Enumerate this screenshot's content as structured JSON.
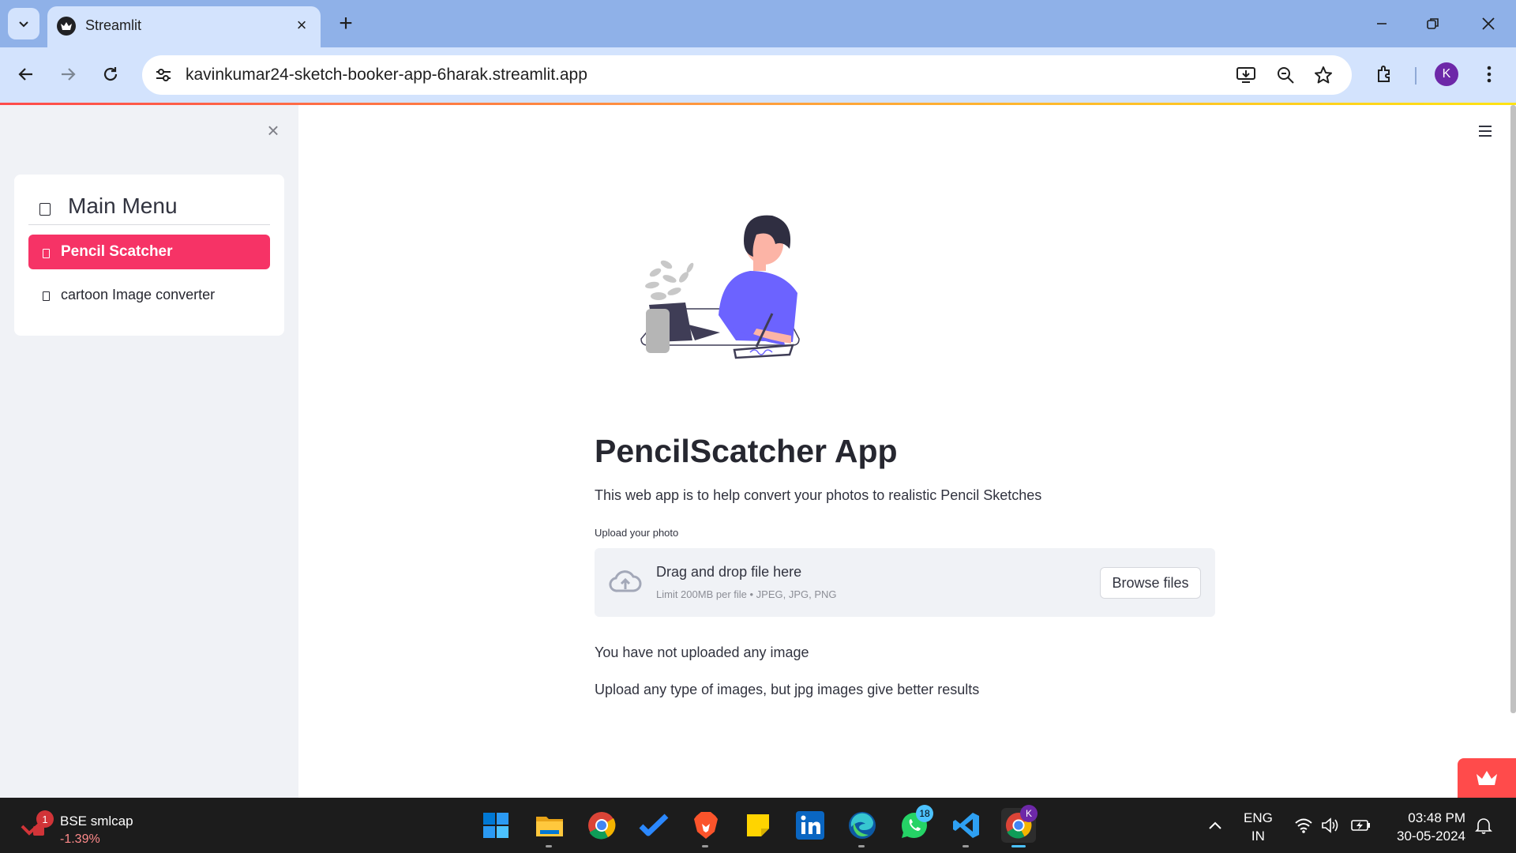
{
  "browser": {
    "tab_title": "Streamlit",
    "url": "kavinkumar24-sketch-booker-app-6harak.streamlit.app",
    "profile_initial": "K"
  },
  "sidebar": {
    "menu_title": "Main Menu",
    "items": [
      {
        "label": "Pencil Scatcher",
        "active": true
      },
      {
        "label": "cartoon Image converter",
        "active": false
      }
    ]
  },
  "main": {
    "title": "PencilScatcher App",
    "description": "This web app is to help convert your photos to realistic Pencil Sketches",
    "uploader": {
      "label": "Upload your photo",
      "drag_text": "Drag and drop file here",
      "limit_text": "Limit 200MB per file • JPEG, JPG, PNG",
      "browse_label": "Browse files"
    },
    "info1": "You have not uploaded any image",
    "info2": "Upload any type of images, but jpg images give better results"
  },
  "taskbar": {
    "stock_badge": "1",
    "stock_name": "BSE smlcap",
    "stock_change": "-1.39%",
    "whatsapp_badge": "18",
    "chrome_badge": "K",
    "lang_line1": "ENG",
    "lang_line2": "IN",
    "time": "03:48 PM",
    "date": "30-05-2024"
  },
  "colors": {
    "accent": "#f63366",
    "streamlit_red": "#ff4b4b",
    "sidebar_bg": "#f0f2f6",
    "browser_frame": "#8fb1e8",
    "illustration_purple": "#6c63ff"
  }
}
